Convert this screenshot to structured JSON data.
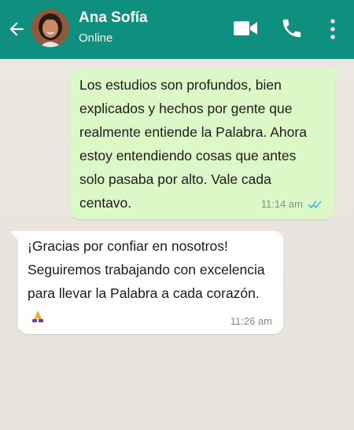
{
  "header": {
    "contact_name": "Ana Sofía",
    "status": "Online",
    "bg_color": "#0f8f7e",
    "icons": [
      "back-arrow-icon",
      "video-call-icon",
      "phone-icon",
      "more-options-icon"
    ]
  },
  "messages": [
    {
      "direction": "outgoing",
      "text": "Los estudios son profundos, bien explicados y hechos por gente que realmente entiende la Palabra. Ahora estoy entendiendo cosas que antes solo pasaba por alto. Vale cada centavo.",
      "time": "11:14 am",
      "read_receipt": "double-check-blue"
    },
    {
      "direction": "incoming",
      "text": "¡Gracias por confiar en nosotros! Seguiremos trabajando con excelencia para llevar la Palabra a cada corazón.",
      "emoji": "praying-hands",
      "time": "11:26 am"
    }
  ],
  "colors": {
    "outgoing_bubble": "#dcf8c6",
    "incoming_bubble": "#ffffff",
    "chat_background": "#e9e4dd",
    "read_tick": "#4fb6ec"
  }
}
